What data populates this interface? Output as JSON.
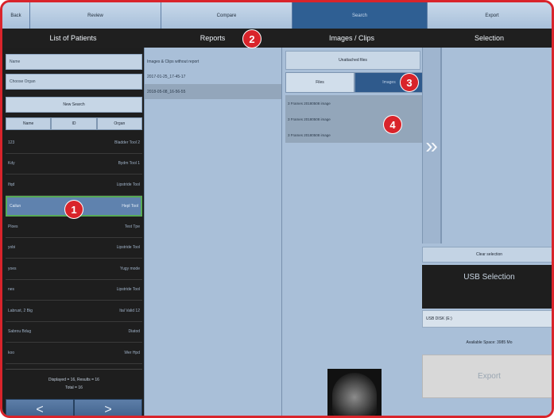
{
  "tabs": [
    {
      "label": "Back",
      "active": false
    },
    {
      "label": "Review",
      "active": false
    },
    {
      "label": "Compare",
      "active": false
    },
    {
      "label": "Search",
      "active": true
    },
    {
      "label": "Export",
      "active": false
    }
  ],
  "columns": {
    "patients": "List of Patients",
    "reports": "Reports",
    "images": "Images / Clips",
    "selection": "Selection"
  },
  "patients_panel": {
    "name_placeholder": "Name",
    "choose_organ": "Choose Organ",
    "new_search": "New Search",
    "sort": [
      "Name",
      "ID",
      "Organ"
    ],
    "rows": [
      {
        "name": "123",
        "organ": "Bladder Tool 2"
      },
      {
        "name": "Kdy",
        "organ": "Bydm Tool 1"
      },
      {
        "name": "Ifqd",
        "organ": "Lipstride Tool"
      },
      {
        "name": "Cailun",
        "organ": "Hepl Tool"
      },
      {
        "name": "Ploes",
        "organ": "Test Tpe"
      },
      {
        "name": "yobi",
        "organ": "Lipstride Tool"
      },
      {
        "name": "yoes",
        "organ": "Yugy mode"
      },
      {
        "name": "nes",
        "organ": "Lipstride Tool"
      },
      {
        "name": "Labrust, 2 Big",
        "organ": "Ital Valid 12"
      },
      {
        "name": "Sabrou Bdug",
        "organ": "Diatod"
      },
      {
        "name": "koo",
        "organ": "Wer Hpd"
      }
    ],
    "selected_index": 3,
    "footer_line1": "Displayed = 16, Results = 16",
    "footer_line2": "Total = 16",
    "prev": "<",
    "next": ">"
  },
  "reports_panel": {
    "rows": [
      "Images & Clips without report",
      "2017-01-25_17-45-17",
      "2018-05-08_16-56-55"
    ],
    "selected_index": 2
  },
  "images_panel": {
    "unattached": "Unattached files",
    "toggle": [
      "Files",
      "Images"
    ],
    "toggle_active": 1,
    "items": [
      "3 Frames 20180508 image",
      "3 Frames 20180508 image",
      "3 Frames 20180508 image"
    ]
  },
  "divider": {
    "icon": "double-chevron-right-icon",
    "glyph": "»"
  },
  "selection_panel": {
    "clear": "Clear selection",
    "usb_title": "USB Selection",
    "usb_drive": "USB DISK (E:)",
    "available": "Available Space: 3985 Mo",
    "export": "Export"
  },
  "callouts": [
    "1",
    "2",
    "3",
    "4"
  ],
  "colors": {
    "callout": "#d9242b",
    "active_tab": "#2f5f93",
    "selected_row": "#5f82ae",
    "selected_border": "#57a957"
  }
}
